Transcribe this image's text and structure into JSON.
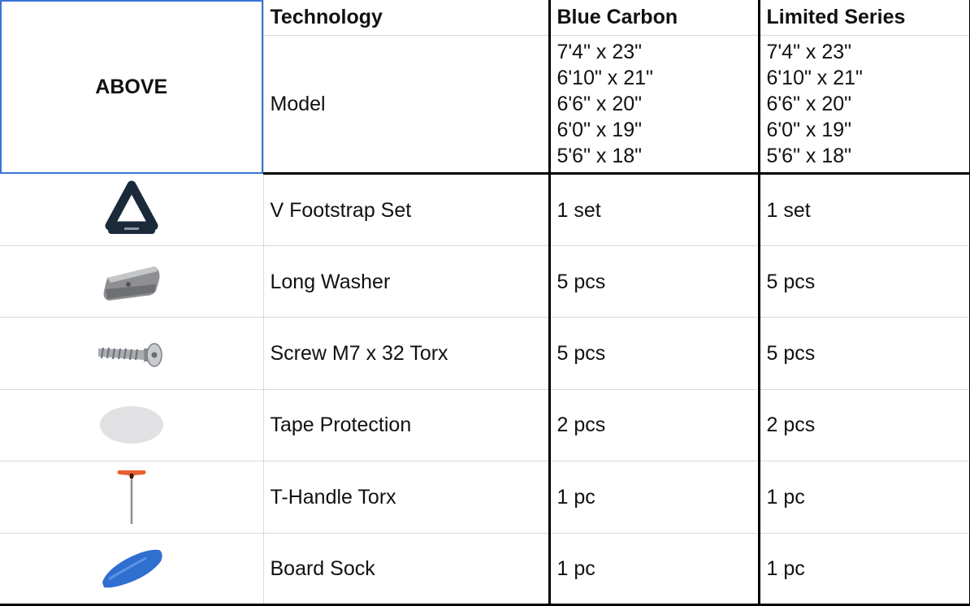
{
  "header": {
    "corner_label": "ABOVE",
    "technology_label": "Technology",
    "col_blue_carbon": "Blue Carbon",
    "col_limited_series": "Limited Series"
  },
  "model_row": {
    "label": "Model",
    "blue_carbon_sizes": [
      "7'4\" x 23\"",
      "6'10\" x 21\"",
      "6'6\" x 20\"",
      "6'0\" x 19\"",
      "5'6\" x 18\""
    ],
    "limited_series_sizes": [
      "7'4\" x 23\"",
      "6'10\" x 21\"",
      "6'6\" x 20\"",
      "6'0\" x 19\"",
      "5'6\" x 18\""
    ]
  },
  "items": [
    {
      "icon": "footstrap-icon",
      "name": "V Footstrap Set",
      "blue_carbon": "1 set",
      "limited_series": "1 set"
    },
    {
      "icon": "long-washer-icon",
      "name": "Long Washer",
      "blue_carbon": "5 pcs",
      "limited_series": "5 pcs"
    },
    {
      "icon": "screw-icon",
      "name": "Screw M7 x 32 Torx",
      "blue_carbon": "5 pcs",
      "limited_series": "5 pcs"
    },
    {
      "icon": "tape-protection-icon",
      "name": "Tape Protection",
      "blue_carbon": "2 pcs",
      "limited_series": "2 pcs"
    },
    {
      "icon": "t-handle-torx-icon",
      "name": "T-Handle Torx",
      "blue_carbon": "1 pc",
      "limited_series": "1 pc"
    },
    {
      "icon": "board-sock-icon",
      "name": "Board Sock",
      "blue_carbon": "1 pc",
      "limited_series": "1 pc"
    }
  ],
  "colors": {
    "selection_outline": "#3b73d6",
    "grid_line": "#d9d9d9",
    "heavy_border": "#000000",
    "board_sock_blue": "#2f6fd0",
    "handle_orange": "#e8612c"
  }
}
